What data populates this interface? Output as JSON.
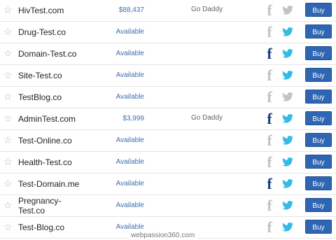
{
  "colors": {
    "price_link": "#3d6fb0",
    "buy_button": "#2e66b3",
    "facebook_active": "#1b3d7a",
    "facebook_inactive": "#c3c3c3",
    "twitter_active": "#33bbe6",
    "twitter_inactive": "#c3c3c3"
  },
  "row_icons": {
    "star": "star-icon",
    "facebook": "facebook-icon",
    "twitter": "twitter-icon",
    "facebook_glyph": "f"
  },
  "rows": [
    {
      "domain": "HivTest.com",
      "price": "$88,437",
      "seller": "Go Daddy",
      "facebook_active": false,
      "twitter_active": false,
      "buy_label": "Buy"
    },
    {
      "domain": "Drug-Test.co",
      "price": "Available",
      "seller": "",
      "facebook_active": false,
      "twitter_active": true,
      "buy_label": "Buy"
    },
    {
      "domain": "Domain-Test.co",
      "price": "Available",
      "seller": "",
      "facebook_active": true,
      "twitter_active": true,
      "buy_label": "Buy"
    },
    {
      "domain": "Site-Test.co",
      "price": "Available",
      "seller": "",
      "facebook_active": false,
      "twitter_active": true,
      "buy_label": "Buy"
    },
    {
      "domain": "TestBlog.co",
      "price": "Available",
      "seller": "",
      "facebook_active": false,
      "twitter_active": false,
      "buy_label": "Buy"
    },
    {
      "domain": "AdminTest.com",
      "price": "$3,999",
      "seller": "Go Daddy",
      "facebook_active": true,
      "twitter_active": true,
      "buy_label": "Buy"
    },
    {
      "domain": "Test-Online.co",
      "price": "Available",
      "seller": "",
      "facebook_active": false,
      "twitter_active": true,
      "buy_label": "Buy"
    },
    {
      "domain": "Health-Test.co",
      "price": "Available",
      "seller": "",
      "facebook_active": false,
      "twitter_active": true,
      "buy_label": "Buy"
    },
    {
      "domain": "Test-Domain.me",
      "price": "Available",
      "seller": "",
      "facebook_active": true,
      "twitter_active": true,
      "buy_label": "Buy"
    },
    {
      "domain": "Pregnancy-Test.co",
      "domain_lines": [
        "Pregnancy-",
        "Test.co"
      ],
      "price": "Available",
      "seller": "",
      "facebook_active": false,
      "twitter_active": true,
      "buy_label": "Buy"
    },
    {
      "domain": "Test-Blog.co",
      "price": "Available",
      "seller": "",
      "facebook_active": false,
      "twitter_active": true,
      "buy_label": "Buy"
    }
  ],
  "watermark": "webpassion360.com"
}
